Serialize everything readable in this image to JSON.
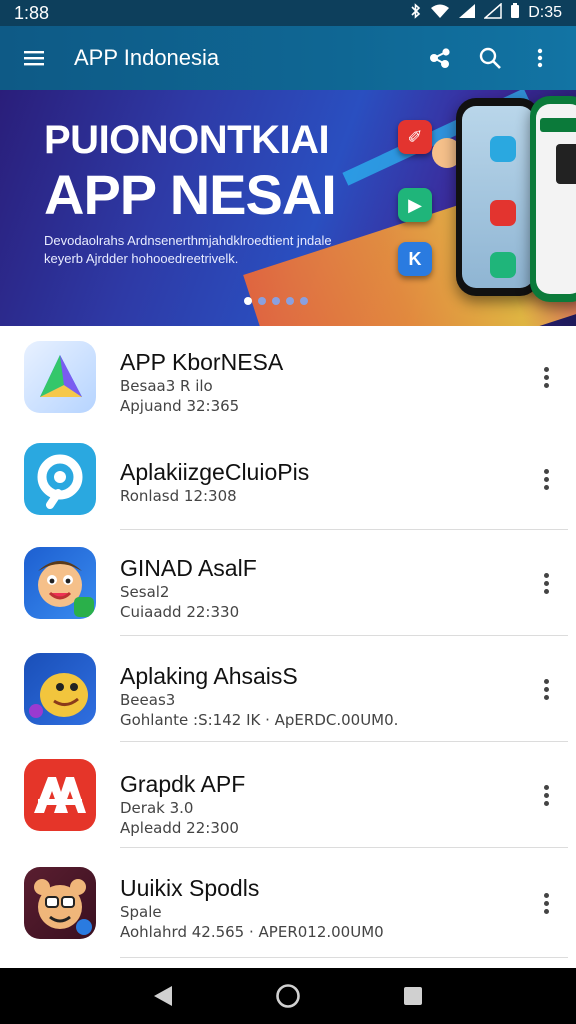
{
  "status_bar": {
    "time": "1:88",
    "clock_right": "D:35"
  },
  "app_bar": {
    "title": "APP Indonesia",
    "icons": [
      "menu-icon",
      "share-icon",
      "search-icon",
      "more-vert-icon"
    ]
  },
  "banner": {
    "headline_1": "PUIONONTKIAI",
    "headline_2": "APP NESAI",
    "subtitle": "Devodaolrahs Ardnsenerthmjahdklroedtient jndale keyerb Ajrdder hohooedreetrivelk.",
    "dots": [
      true,
      false,
      false,
      false,
      false
    ]
  },
  "apps": [
    {
      "name": "APP KborNESA",
      "lines": [
        "Besaa3 R  ilo",
        "Apjuand 32:365"
      ],
      "icon": "play-triangle-icon",
      "colors": [
        "#e8f1ff",
        "#4fb3ff"
      ]
    },
    {
      "name": "AplakiizgeCluioPis",
      "lines": [
        "Ronlasd 12:308"
      ],
      "icon": "camera-ring-icon",
      "colors": [
        "#2aa8e0",
        "#ffffff"
      ]
    },
    {
      "name": "GINAD AsalF",
      "lines": [
        "Sesal2",
        "Cuiaadd 22:330"
      ],
      "icon": "cartoon-face-icon",
      "colors": [
        "#1d5fd0",
        "#f7c948"
      ]
    },
    {
      "name": "Aplaking AhsaisS",
      "lines": [
        "Beeas3",
        "Gohlante :S:142 IK · ApERDC.00UM0."
      ],
      "icon": "yellow-character-icon",
      "colors": [
        "#1a4fb8",
        "#f2c53d"
      ]
    },
    {
      "name": "Grapdk APF",
      "lines": [
        "Derak 3.0",
        "Apleadd 22:300"
      ],
      "icon": "red-a-logo-icon",
      "colors": [
        "#e53529",
        "#ffffff"
      ]
    },
    {
      "name": "Uuikix Spodls",
      "lines": [
        "Spale",
        "Aohlahrd 42.565 · APER012.00UM0"
      ],
      "icon": "bear-character-icon",
      "colors": [
        "#4a1828",
        "#f0b67a"
      ]
    }
  ],
  "nav_bar": {
    "icons": [
      "back-icon",
      "home-icon",
      "recents-icon"
    ]
  }
}
